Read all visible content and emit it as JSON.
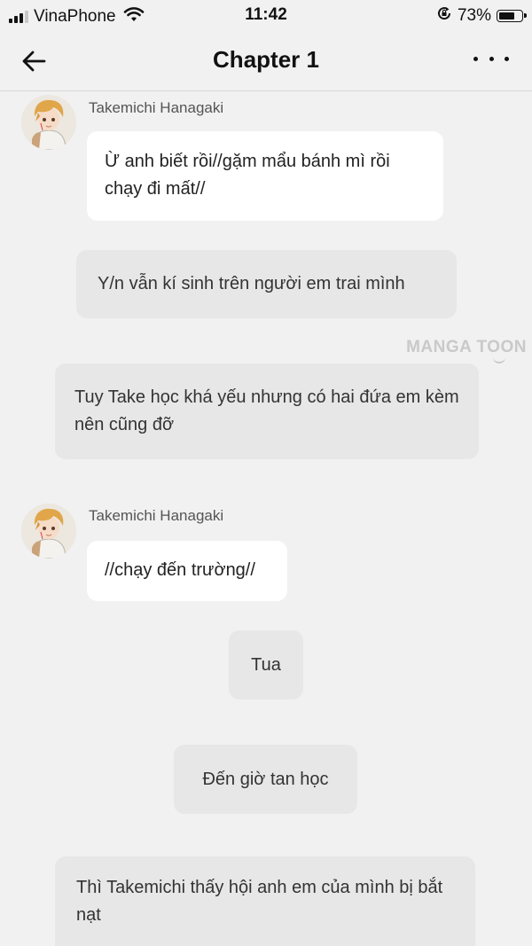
{
  "status_bar": {
    "carrier": "VinaPhone",
    "time": "11:42",
    "battery_percent": "73%",
    "battery_level": 0.73,
    "signal_bars_active": 3,
    "icons": [
      "signal-icon",
      "wifi-icon",
      "orientation-lock-icon",
      "battery-icon"
    ]
  },
  "nav": {
    "title": "Chapter 1",
    "back_icon": "arrow-left-icon",
    "menu_icon": "more-dots-icon"
  },
  "watermark": {
    "text": "MANGA TOON"
  },
  "messages": [
    {
      "type": "character",
      "sender": "Takemichi Hanagaki",
      "text": "Ừ anh biết rồi//gặm mẩu bánh mì rồi chạy đi mất//"
    },
    {
      "type": "narration",
      "text": "Y/n vẫn kí sinh trên người em trai mình"
    },
    {
      "type": "narration",
      "text": "Tuy Take học khá yếu nhưng có hai đứa em kèm nên cũng đỡ"
    },
    {
      "type": "character",
      "sender": "Takemichi Hanagaki",
      "text": "//chạy đến trường//"
    },
    {
      "type": "narration",
      "text": "Tua"
    },
    {
      "type": "narration",
      "text": "Đến giờ tan học"
    },
    {
      "type": "narration",
      "text": "Thì Takemichi thấy hội anh em của mình bị bắt nạt"
    }
  ],
  "colors": {
    "background": "#f1f1f1",
    "bubble": "#ffffff",
    "narration_bubble": "#e7e7e7",
    "avatar_hair": "#e0a649"
  }
}
